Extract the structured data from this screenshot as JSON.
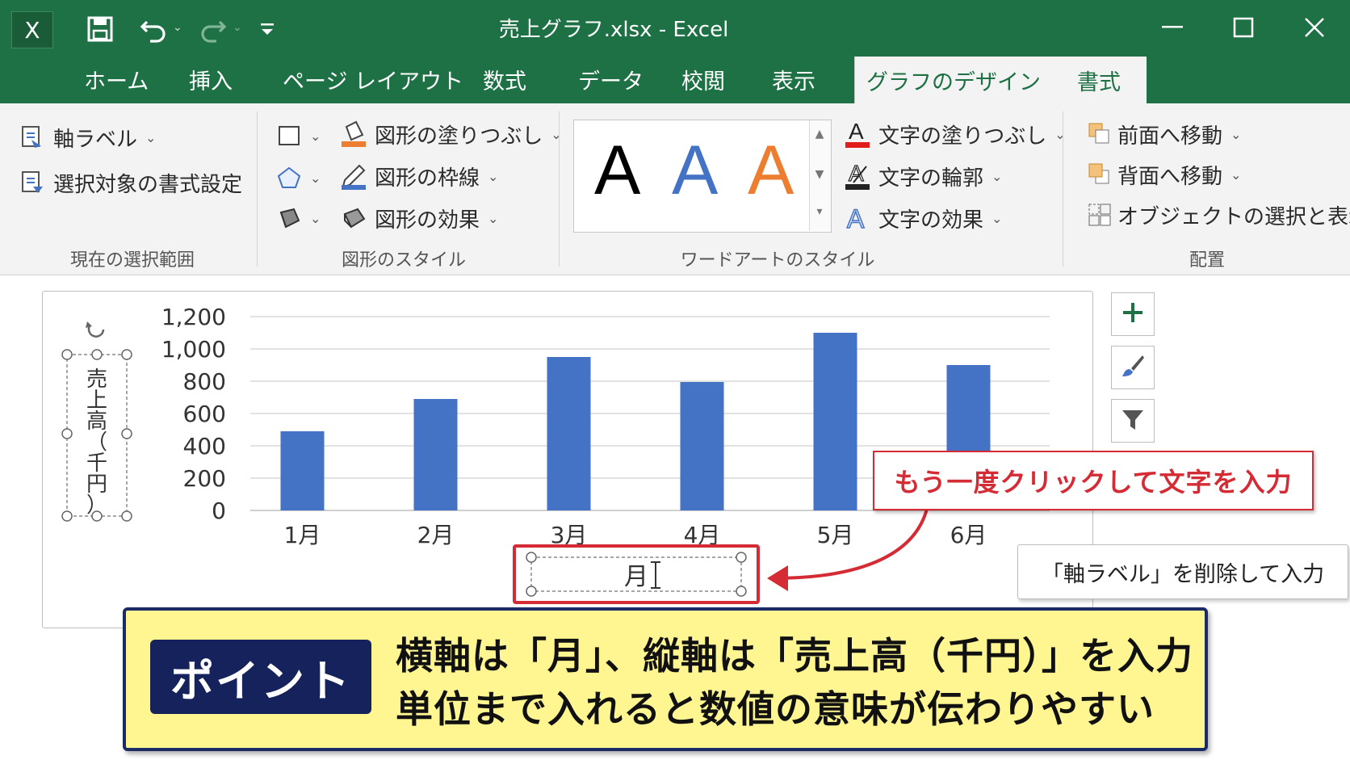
{
  "window": {
    "title": "売上グラフ.xlsx  -  Excel",
    "app_icon_label": "X",
    "quick_access": [
      "save-icon",
      "undo-icon",
      "redo-icon",
      "customize-icon"
    ],
    "controls": [
      "minimize-icon",
      "maximize-icon",
      "close-icon"
    ]
  },
  "tabs": [
    {
      "label": "ホーム"
    },
    {
      "label": "挿入"
    },
    {
      "label": "ページ レイアウト"
    },
    {
      "label": "数式"
    },
    {
      "label": "データ"
    },
    {
      "label": "校閲"
    },
    {
      "label": "表示"
    },
    {
      "label": "グラフのデザイン",
      "active": true
    },
    {
      "label": "書式"
    }
  ],
  "ribbon": {
    "current_selection": {
      "group_label": "現在の選択範囲",
      "selected_element": "軸ラベル",
      "format_selection": "選択対象の書式設定"
    },
    "shape_styles": {
      "group_label": "図形のスタイル",
      "fill": "図形の塗りつぶし",
      "outline": "図形の枠線",
      "effects": "図形の効果"
    },
    "wordart_styles": {
      "group_label": "ワードアートのスタイル",
      "samples": [
        "A",
        "A",
        "A"
      ],
      "sample_colors": [
        "#000000",
        "#4472c4",
        "#ed7d31"
      ],
      "text_fill": "文字の塗りつぶし",
      "text_outline": "文字の輪郭",
      "text_effects": "文字の効果"
    },
    "arrange": {
      "group_label": "配置",
      "bring_forward": "前面へ移動",
      "send_backward": "背面へ移動",
      "selection_pane": "オブジェクトの選択と表示"
    }
  },
  "chart_data": {
    "type": "bar",
    "categories": [
      "1月",
      "2月",
      "3月",
      "4月",
      "5月",
      "6月"
    ],
    "values": [
      490,
      690,
      950,
      795,
      1100,
      900
    ],
    "ylim": [
      0,
      1200
    ],
    "yticks": [
      "0",
      "200",
      "400",
      "600",
      "800",
      "1,000",
      "1,200"
    ],
    "xlabel": "月",
    "ylabel": "売上高（千円）",
    "ylabel_chars": [
      "売",
      "上",
      "高",
      "（",
      "千",
      "円",
      "）"
    ],
    "bar_color": "#4472c4",
    "grid": true
  },
  "chart_side_buttons": [
    "plus-icon",
    "brush-icon",
    "filter-icon"
  ],
  "annotations": {
    "red_callout": "もう一度クリックして文字を入力",
    "note": "「軸ラベル」を削除して入力"
  },
  "point": {
    "badge": "ポイント",
    "line1": "横軸は「月」、縦軸は「売上高（千円）」を入力",
    "line2": "単位まで入れると数値の意味が伝わりやすい"
  },
  "colors": {
    "excel_green": "#1e7045",
    "accent_red": "#d42b35",
    "point_bg": "#fff691",
    "point_badge": "#15225c"
  }
}
